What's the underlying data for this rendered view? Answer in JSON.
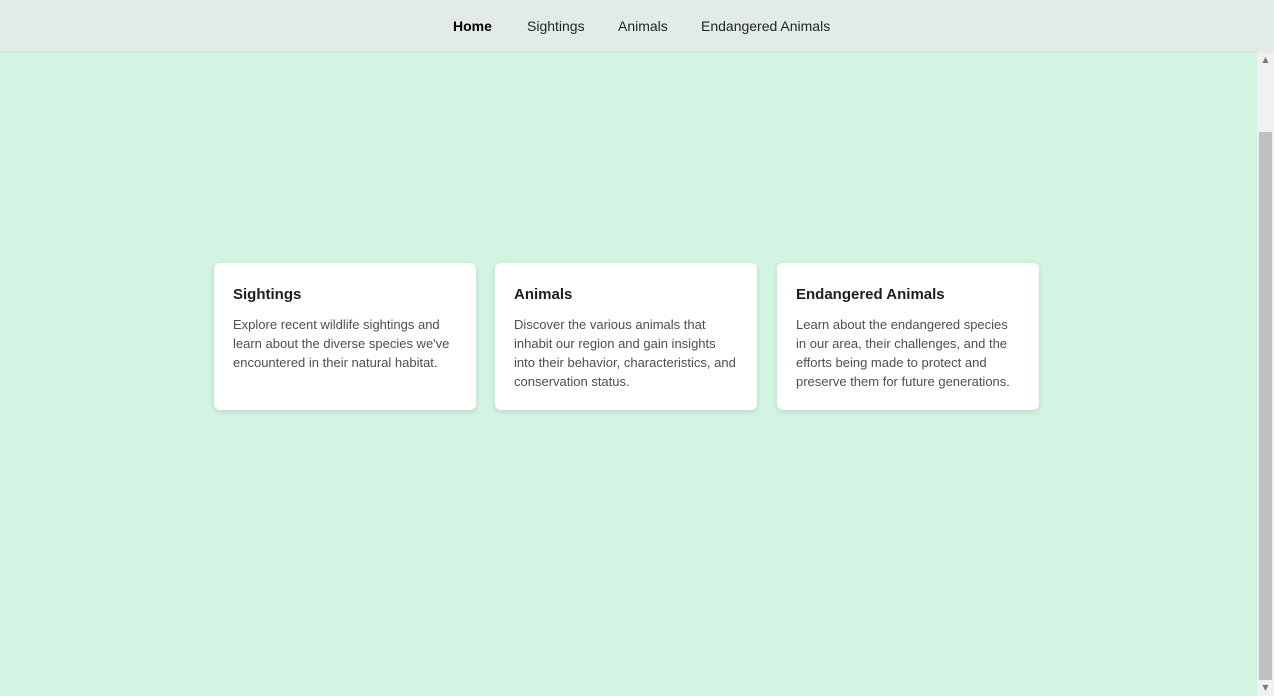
{
  "nav": {
    "items": [
      {
        "label": "Home",
        "active": true
      },
      {
        "label": "Sightings",
        "active": false
      },
      {
        "label": "Animals",
        "active": false
      },
      {
        "label": "Endangered Animals",
        "active": false
      }
    ]
  },
  "cards": [
    {
      "title": "Sightings",
      "text": "Explore recent wildlife sightings and learn about the diverse species we've encountered in their natural habitat."
    },
    {
      "title": "Animals",
      "text": "Discover the various animals that inhabit our region and gain insights into their behavior, characteristics, and conservation status."
    },
    {
      "title": "Endangered Animals",
      "text": "Learn about the endangered species in our area, their challenges, and the efforts being made to protect and preserve them for future generations."
    }
  ],
  "colors": {
    "page_background": "#d3f4e2",
    "navbar_background": "#e2ebe6",
    "card_background": "#ffffff"
  },
  "icons": {
    "scroll_up": "triangle-up",
    "scroll_down": "triangle-down"
  }
}
